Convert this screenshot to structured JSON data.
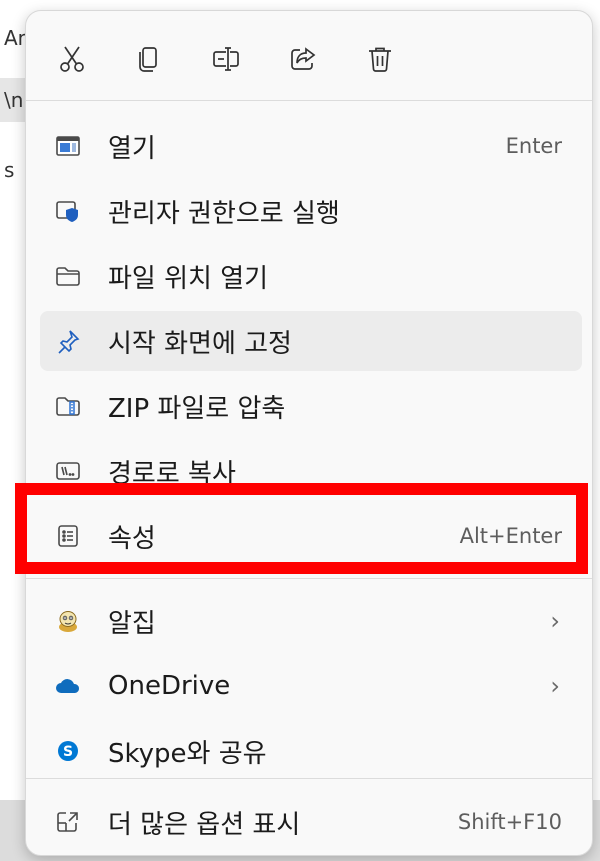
{
  "background": {
    "rows": [
      "An",
      "\\n",
      "s"
    ]
  },
  "toolbar": {
    "cut_icon": "scissors-icon",
    "copy_icon": "copy-icon",
    "rename_icon": "rename-icon",
    "share_icon": "share-icon",
    "delete_icon": "trash-icon"
  },
  "menu": {
    "items": [
      {
        "label": "열기",
        "shortcut": "Enter",
        "icon": "window-icon"
      },
      {
        "label": "관리자 권한으로 실행",
        "shortcut": "",
        "icon": "shield-icon"
      },
      {
        "label": "파일 위치 열기",
        "shortcut": "",
        "icon": "folder-icon"
      },
      {
        "label": "시작 화면에 고정",
        "shortcut": "",
        "icon": "pin-icon"
      },
      {
        "label": "ZIP 파일로 압축",
        "shortcut": "",
        "icon": "zip-folder-icon"
      },
      {
        "label": "경로로 복사",
        "shortcut": "",
        "icon": "path-icon"
      },
      {
        "label": "속성",
        "shortcut": "Alt+Enter",
        "icon": "properties-icon"
      },
      {
        "label": "알집",
        "shortcut": "",
        "icon": "alzip-icon"
      },
      {
        "label": "OneDrive",
        "shortcut": "",
        "icon": "cloud-icon"
      },
      {
        "label": "Skype와 공유",
        "shortcut": "",
        "icon": "skype-icon"
      },
      {
        "label": "더 많은 옵션 표시",
        "shortcut": "Shift+F10",
        "icon": "more-options-icon"
      }
    ],
    "chevron": "›"
  },
  "colors": {
    "highlight": "#ff0000",
    "onedrive": "#0f6cbd",
    "skype": "#0078d4",
    "shield": "#1f5fbf"
  }
}
